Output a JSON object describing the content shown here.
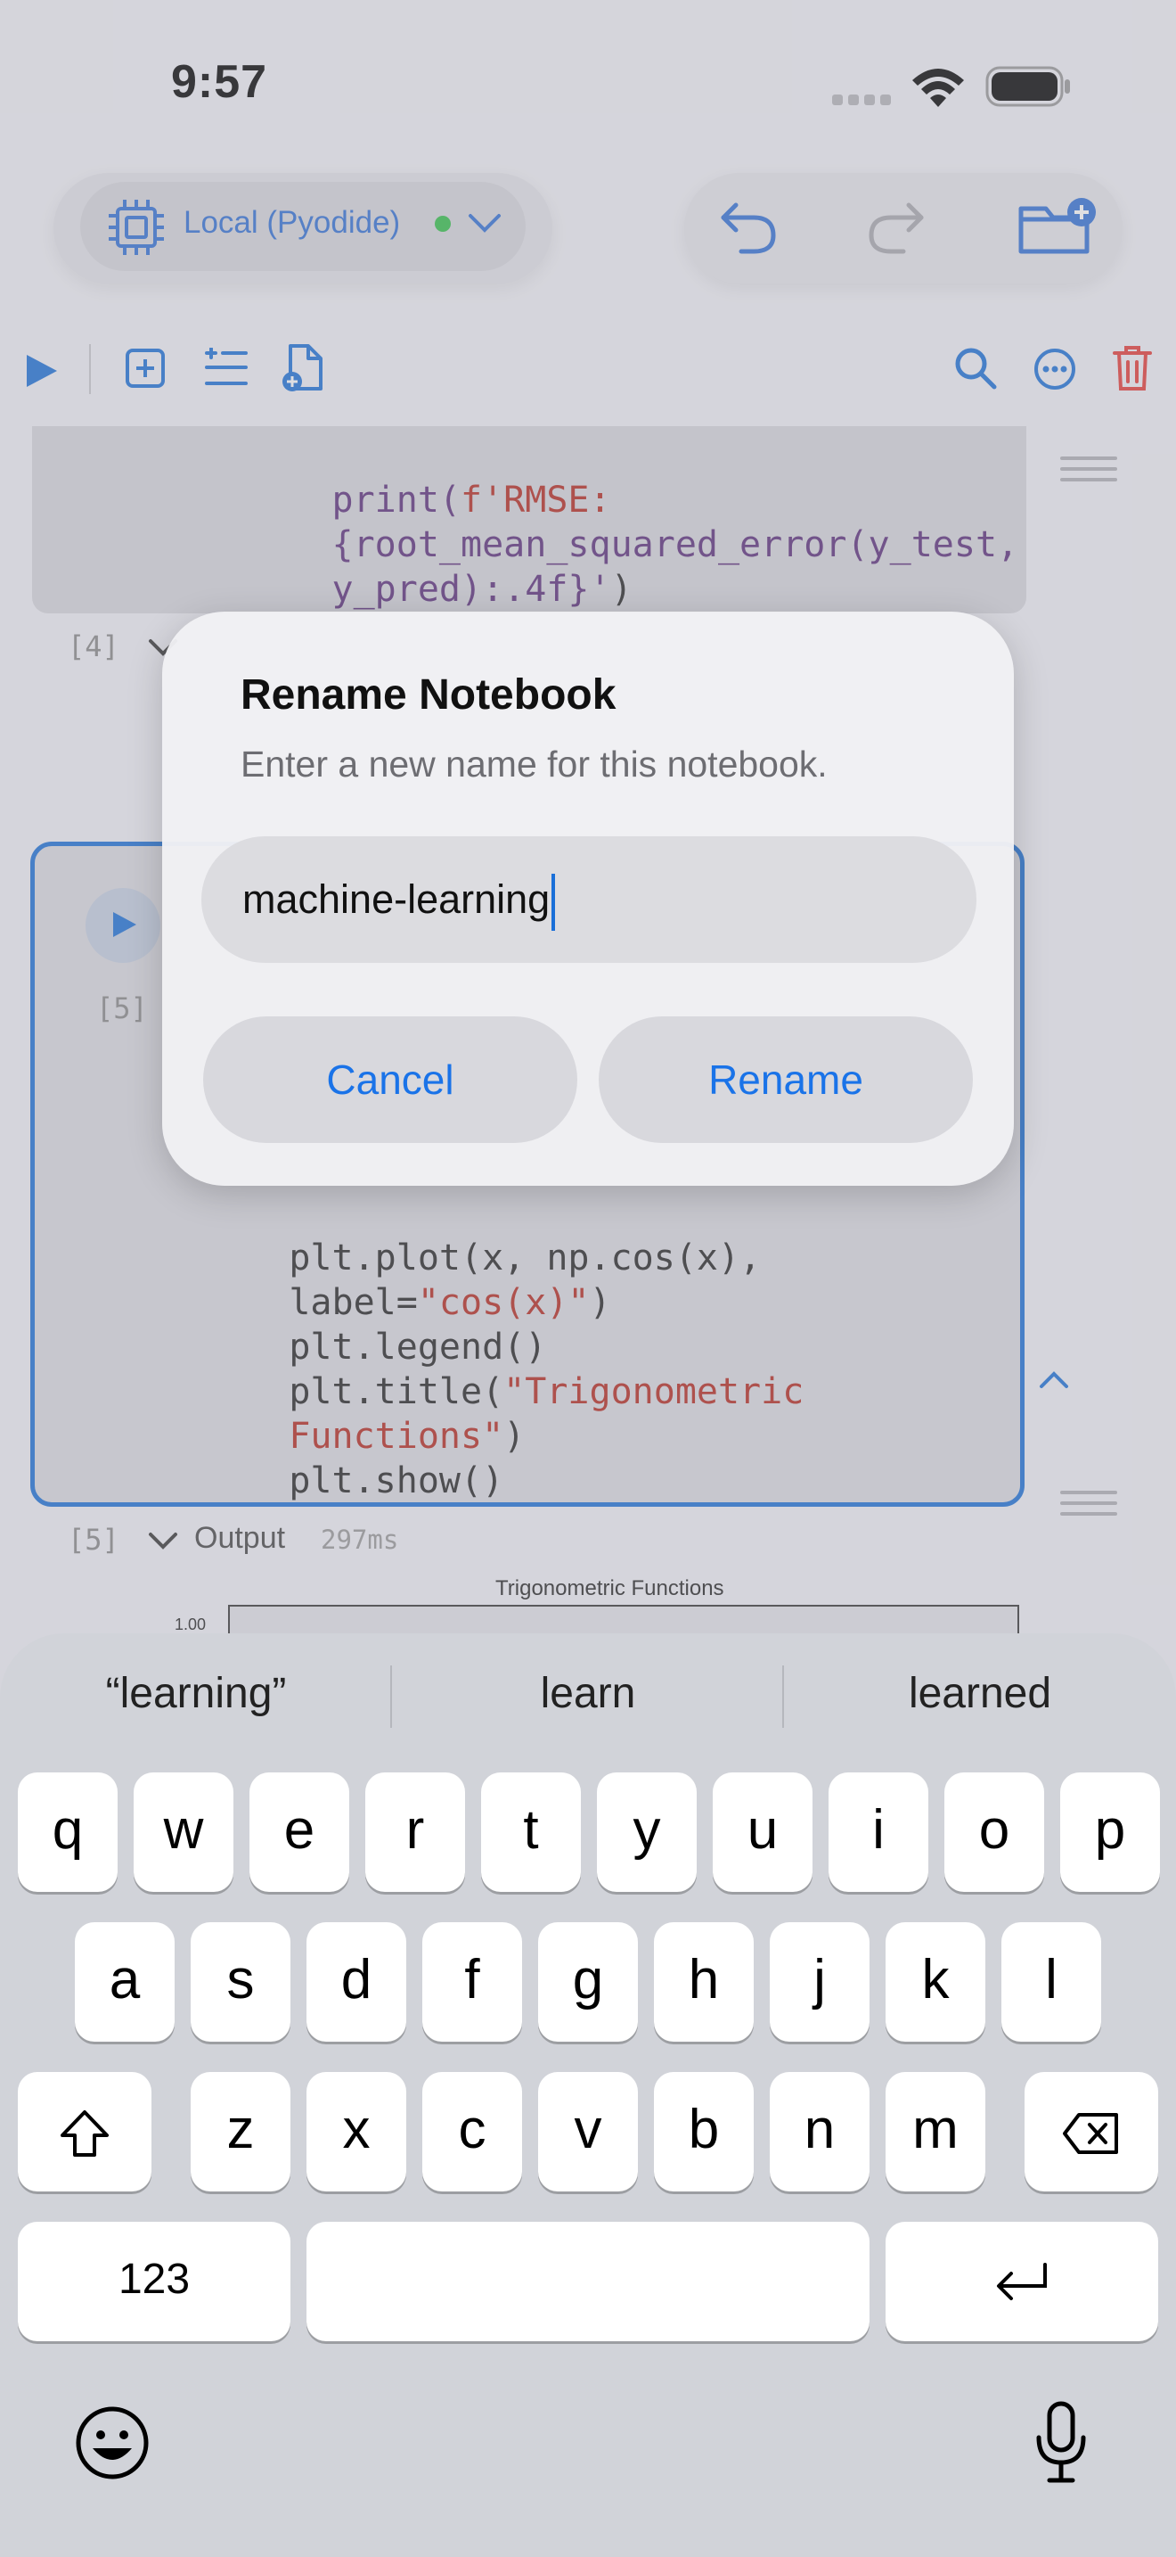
{
  "status_bar": {
    "time": "9:57"
  },
  "header": {
    "kernel_label": "Local (Pyodide)"
  },
  "cells": [
    {
      "code": [
        {
          "parts": [
            [
              "print(",
              "fn"
            ],
            [
              "f'RMSE:",
              "str"
            ]
          ]
        },
        {
          "parts": [
            [
              "{root_mean_squared_error(y_test,",
              "fn"
            ]
          ]
        },
        {
          "parts": [
            [
              "y_pred):.4f}'",
              "fn"
            ],
            [
              ")",
              "def"
            ]
          ]
        }
      ]
    },
    {
      "exec": "[4]"
    },
    {
      "exec": "[5]",
      "code": [
        {
          "parts": [
            [
              "plt.plot(x, np.cos(x),",
              "def"
            ]
          ]
        },
        {
          "parts": [
            [
              "label=",
              "def"
            ],
            [
              "\"cos(x)\"",
              "str"
            ],
            [
              ")",
              "def"
            ]
          ]
        },
        {
          "parts": [
            [
              "plt.legend()",
              "def"
            ]
          ]
        },
        {
          "parts": [
            [
              "plt.title(",
              "def"
            ],
            [
              "\"Trigonometric",
              "str"
            ]
          ]
        },
        {
          "parts": [
            [
              "Functions\"",
              "str"
            ],
            [
              ")",
              "def"
            ]
          ]
        },
        {
          "parts": [
            [
              "plt.show()",
              "def"
            ]
          ]
        }
      ]
    }
  ],
  "output": {
    "exec": "[5]",
    "label": "Output",
    "time": "297ms",
    "chart_title": "Trigonometric Functions",
    "y_tick": "1.00"
  },
  "dialog": {
    "title": "Rename Notebook",
    "message": "Enter a new name for this notebook.",
    "input_value": "machine-learning",
    "cancel_label": "Cancel",
    "rename_label": "Rename"
  },
  "keyboard": {
    "suggestions": [
      "“learning”",
      "learn",
      "learned"
    ],
    "row1": [
      "q",
      "w",
      "e",
      "r",
      "t",
      "y",
      "u",
      "i",
      "o",
      "p"
    ],
    "row2": [
      "a",
      "s",
      "d",
      "f",
      "g",
      "h",
      "j",
      "k",
      "l"
    ],
    "row3": [
      "z",
      "x",
      "c",
      "v",
      "b",
      "n",
      "m"
    ],
    "numbers_label": "123"
  },
  "colors": {
    "accent": "#1a73e8",
    "destructive": "#e53935",
    "kernel_status": "#30c048"
  }
}
